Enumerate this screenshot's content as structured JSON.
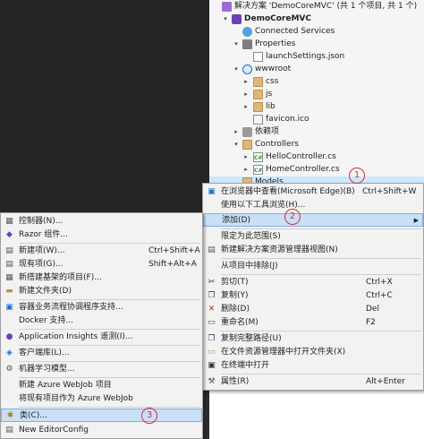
{
  "solution_explorer": {
    "rows": [
      {
        "label": "解决方案 'DemoCoreMVC' (共 1 个项目, 共 1 个)",
        "icon": "solution-icon",
        "arrow": ""
      },
      {
        "label": "DemoCoreMVC",
        "icon": "project-icon",
        "arrow": "▾"
      },
      {
        "label": "Connected Services",
        "icon": "connected-services-icon",
        "arrow": ""
      },
      {
        "label": "Properties",
        "icon": "wrench-icon",
        "arrow": "▾"
      },
      {
        "label": "launchSettings.json",
        "icon": "json-file-icon",
        "arrow": ""
      },
      {
        "label": "wwwroot",
        "icon": "globe-icon",
        "arrow": "▾"
      },
      {
        "label": "css",
        "icon": "folder-icon",
        "arrow": "▸"
      },
      {
        "label": "js",
        "icon": "folder-icon",
        "arrow": "▸"
      },
      {
        "label": "lib",
        "icon": "folder-icon",
        "arrow": "▸"
      },
      {
        "label": "favicon.ico",
        "icon": "ico-file-icon",
        "arrow": ""
      },
      {
        "label": "依赖项",
        "icon": "dependencies-icon",
        "arrow": "▸"
      },
      {
        "label": "Controllers",
        "icon": "folder-icon",
        "arrow": "▾"
      },
      {
        "label": "HelloController.cs",
        "icon": "csharp-file-icon",
        "arrow": "▸"
      },
      {
        "label": "HomeController.cs",
        "icon": "csharp-file-icon",
        "arrow": "▸"
      },
      {
        "label": "Models",
        "icon": "folder-icon",
        "arrow": ""
      }
    ]
  },
  "context_menu": {
    "items": [
      {
        "label": "在浏览器中查看(Microsoft Edge)(B)",
        "shortcut": "Ctrl+Shift+W",
        "icon": "browser-icon"
      },
      {
        "label": "使用以下工具浏览(H)...",
        "shortcut": "",
        "icon": ""
      },
      {
        "label": "添加(D)",
        "shortcut": "",
        "icon": ""
      },
      {
        "label": "限定为此范围(S)",
        "shortcut": "",
        "icon": ""
      },
      {
        "label": "新建解决方案资源管理器视图(N)",
        "shortcut": "",
        "icon": "new-view-icon"
      },
      {
        "label": "从项目中排除(J)",
        "shortcut": "",
        "icon": ""
      },
      {
        "label": "剪切(T)",
        "shortcut": "Ctrl+X",
        "icon": "cut-icon"
      },
      {
        "label": "复制(Y)",
        "shortcut": "Ctrl+C",
        "icon": "copy-icon"
      },
      {
        "label": "删除(D)",
        "shortcut": "Del",
        "icon": "delete-icon"
      },
      {
        "label": "重命名(M)",
        "shortcut": "F2",
        "icon": "rename-icon"
      },
      {
        "label": "复制完整路径(U)",
        "shortcut": "",
        "icon": "copy-path-icon"
      },
      {
        "label": "在文件资源管理器中打开文件夹(X)",
        "shortcut": "",
        "icon": "folder-open-icon"
      },
      {
        "label": "在终端中打开",
        "shortcut": "",
        "icon": "terminal-icon"
      },
      {
        "label": "属性(R)",
        "shortcut": "Alt+Enter",
        "icon": "properties-icon"
      }
    ]
  },
  "add_submenu": {
    "items": [
      {
        "label": "控制器(N)...",
        "shortcut": "",
        "icon": "controller-icon"
      },
      {
        "label": "Razor 组件...",
        "shortcut": "",
        "icon": "razor-icon"
      },
      {
        "label": "新建项(W)...",
        "shortcut": "Ctrl+Shift+A",
        "icon": "new-item-icon"
      },
      {
        "label": "现有项(G)...",
        "shortcut": "Shift+Alt+A",
        "icon": "existing-item-icon"
      },
      {
        "label": "新搭建基架的项目(F)...",
        "shortcut": "",
        "icon": "scaffold-icon"
      },
      {
        "label": "新建文件夹(D)",
        "shortcut": "",
        "icon": "new-folder-icon"
      },
      {
        "label": "容器业务流程协调程序支持...",
        "shortcut": "",
        "icon": "container-icon"
      },
      {
        "label": "Docker 支持...",
        "shortcut": "",
        "icon": ""
      },
      {
        "label": "Application Insights 遥测(I)...",
        "shortcut": "",
        "icon": "insights-icon"
      },
      {
        "label": "客户端库(L)...",
        "shortcut": "",
        "icon": "client-library-icon"
      },
      {
        "label": "机器学习模型...",
        "shortcut": "",
        "icon": "ml-model-icon"
      },
      {
        "label": "新建 Azure WebJob 项目",
        "shortcut": "",
        "icon": ""
      },
      {
        "label": "将现有项目作为 Azure WebJob",
        "shortcut": "",
        "icon": ""
      },
      {
        "label": "类(C)...",
        "shortcut": "",
        "icon": "class-icon"
      },
      {
        "label": "New EditorConfig",
        "shortcut": "",
        "icon": "editorconfig-icon"
      }
    ]
  },
  "annotations": [
    "1",
    "2",
    "3"
  ]
}
